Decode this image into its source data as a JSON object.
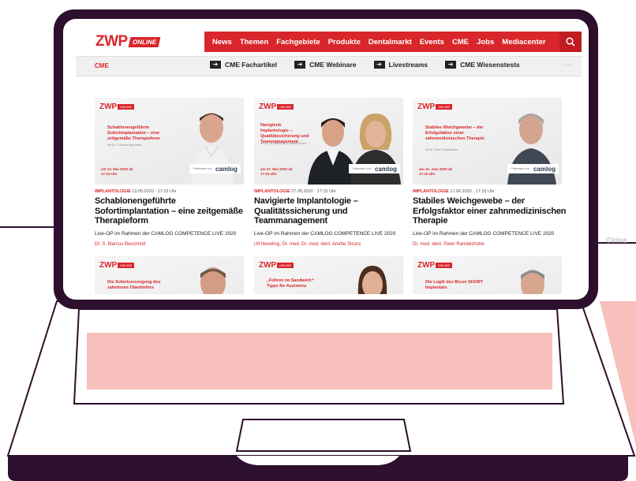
{
  "header": {
    "logo_text": "ZWP",
    "logo_badge": "ONLINE",
    "nav": [
      "News",
      "Themen",
      "Fachgebiete",
      "Produkte",
      "Dentalmarkt",
      "Events",
      "CME",
      "Jobs",
      "Mediacenter"
    ],
    "search_icon": "search-icon"
  },
  "subnav": {
    "section": "CME",
    "links": [
      "CME Fachartikel",
      "CME Webinare",
      "Livestreams",
      "CME Wissenstests"
    ],
    "more": "···"
  },
  "cards": [
    {
      "thumb_logo": "ZWP",
      "thumb_logo_badge": "ONLINE",
      "thumb_title": "Schablonengeführte Sofortimplantation – eine zeitgemäße Therapieform",
      "thumb_subtitle": "mit Dr. S. Marcus Beschnidt",
      "thumb_date": "am 13. Mai 2020 ab 17:15 Uhr",
      "badge_pre": "Präsentiert von:",
      "badge_brand": "camlog",
      "category": "IMPLANTOLOGIE",
      "datetime": "13.05.2020 · 17:15 Uhr",
      "title": "Schablonengeführte Sofortimplantation – eine zeitgemäße Therapieform",
      "description": "Live-OP im Rahmen der CAMLOG COMPETENCE LIVE 2020",
      "author": "Dr. S. Marcus Beschnidt"
    },
    {
      "thumb_logo": "ZWP",
      "thumb_logo_badge": "ONLINE",
      "thumb_title": "Navigierte Implantologie – Qualitätssicherung und Teammanagement",
      "thumb_subtitle": "mit Dr. Ulf Neveling, Dr. Anette Strunz",
      "thumb_date": "am 27. Mai 2020 ab 17:15 Uhr",
      "badge_pre": "Präsentiert von:",
      "badge_brand": "camlog",
      "category": "IMPLANTOLOGIE",
      "datetime": "27.05.2020 · 17:15 Uhr",
      "title": "Navigierte Implantologie – Qualitätssicherung und Teammanagement",
      "description": "Live-OP im Rahmen der CAMLOG COMPETENCE LIVE 2020",
      "author": "Ulf Neveling, Dr. med. Dr. med. dent. Anette Strunz"
    },
    {
      "thumb_logo": "ZWP",
      "thumb_logo_badge": "ONLINE",
      "thumb_title": "Stabiles Weichgewebe – der Erfolgsfaktor einer zahnmedizinischen Therapie",
      "thumb_subtitle": "mit Dr. Peter Randelzhofer",
      "thumb_date": "am 10. Juni 2020 ab 17:15 Uhr",
      "badge_pre": "Präsentiert von:",
      "badge_brand": "camlog",
      "category": "IMPLANTOLOGIE",
      "datetime": "17.06.2020 · 17:15 Uhr",
      "title": "Stabiles Weichgewebe – der Erfolgsfaktor einer zahnmedizinischen Therapie",
      "description": "Live-OP im Rahmen der CAMLOG COMPETENCE LIVE 2020",
      "author": "Dr. med. dent. Peter Randelzhofer"
    },
    {
      "thumb_logo": "ZWP",
      "thumb_logo_badge": "ONLINE",
      "thumb_title": "Die Sofortversorgung des zahnlosen Oberkiefers"
    },
    {
      "thumb_logo": "ZWP",
      "thumb_logo_badge": "ONLINE",
      "thumb_title": "„Führen im Sandwich“: Tipps für Assistenz"
    },
    {
      "thumb_logo": "ZWP",
      "thumb_logo_badge": "ONLINE",
      "thumb_title": "Die Logik des Bicon SHORT Implantats"
    }
  ],
  "watermark": "©irina",
  "colors": {
    "brand_red": "#d8262b",
    "laptop_outline": "#2d0f2e",
    "accent_pink": "#f8c0bd"
  }
}
